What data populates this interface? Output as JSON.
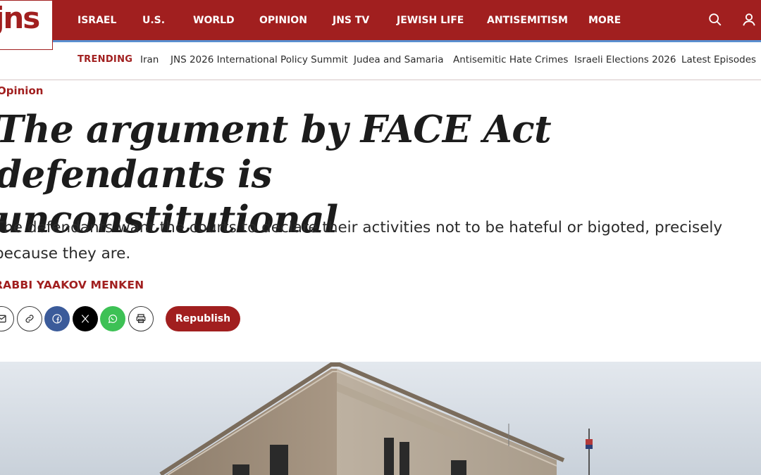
{
  "brand": {
    "logo_text": "jns"
  },
  "nav": {
    "items": [
      "ISRAEL",
      "U.S.",
      "WORLD",
      "OPINION",
      "JNS TV",
      "JEWISH LIFE",
      "ANTISEMITISM",
      "MORE"
    ],
    "icons": [
      "search-icon",
      "user-icon"
    ]
  },
  "trending": {
    "label": "TRENDING",
    "links": [
      "Iran",
      "JNS 2026 International Policy Summit",
      "Judea and Samaria",
      "Antisemitic Hate Crimes",
      "Israeli Elections 2026",
      "Latest Episodes"
    ]
  },
  "article": {
    "category": "Opinion",
    "headline_line1": "The argument by FACE Act defendants is",
    "headline_line2": "unconstitutional",
    "subhead_line1": "The defendants want the courts to declare their activities not to be hateful or bigoted, precisely",
    "subhead_line2": "because they are.",
    "byline": "RABBI YAAKOV MENKEN"
  },
  "share": {
    "buttons": [
      "email-icon",
      "link-icon",
      "facebook-icon",
      "x-icon",
      "whatsapp-icon",
      "print-icon"
    ],
    "republish_label": "Republish"
  },
  "colors": {
    "brand_red": "#a11f1f",
    "accent_blue": "#5a8fd0",
    "facebook": "#3b5b9a",
    "whatsapp": "#3dc155"
  }
}
